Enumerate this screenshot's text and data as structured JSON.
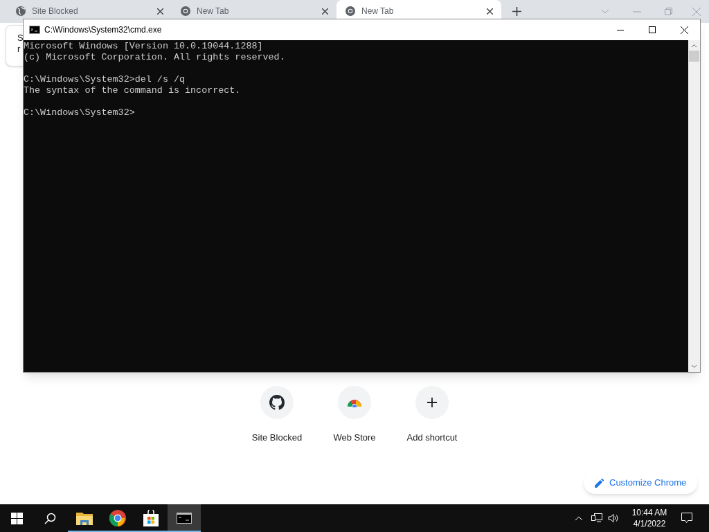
{
  "browser": {
    "tabs": [
      {
        "title": "Site Blocked",
        "kind": "globe",
        "selected": false
      },
      {
        "title": "New Tab",
        "kind": "chrome",
        "selected": false
      },
      {
        "title": "New Tab",
        "kind": "chrome",
        "selected": true
      }
    ],
    "behind_card": {
      "lines": [
        "S",
        "r"
      ]
    },
    "shortcuts": [
      {
        "label": "Site Blocked",
        "kind": "github"
      },
      {
        "label": "Web Store",
        "kind": "webstore"
      },
      {
        "label": "Add shortcut",
        "kind": "plus"
      }
    ],
    "customize_button": "Customize Chrome"
  },
  "console": {
    "title": "C:\\Windows\\System32\\cmd.exe",
    "blocks": [
      {
        "lines": [
          "Microsoft Windows [Version 10.0.19044.1288]",
          "(c) Microsoft Corporation. All rights reserved."
        ]
      },
      {
        "lines": [
          "C:\\Windows\\System32>del /s /q",
          "The syntax of the command is incorrect."
        ]
      },
      {
        "lines": [
          "C:\\Windows\\System32>"
        ]
      }
    ]
  },
  "taskbar": {
    "apps": [
      {
        "kind": "explorer",
        "selected": false
      },
      {
        "kind": "chrome",
        "selected": false
      },
      {
        "kind": "store",
        "selected": false
      },
      {
        "kind": "cmd",
        "selected": true
      }
    ],
    "time": "10:44 AM",
    "date": "4/1/2022"
  }
}
